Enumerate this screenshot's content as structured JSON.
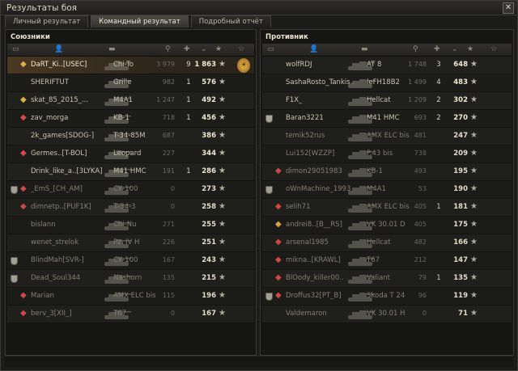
{
  "window": {
    "title": "Результаты боя",
    "close_glyph": "✕"
  },
  "tabs": [
    {
      "label": "Личный результат",
      "active": false
    },
    {
      "label": "Командный результат",
      "active": true
    },
    {
      "label": "Подробный отчёт",
      "active": false
    }
  ],
  "allies": {
    "title": "Союзники",
    "rows": [
      {
        "clan": false,
        "rank": "gold",
        "name": "DaRT_Ki..[USEC]",
        "vehicle": "Chi-To",
        "damage": "3 979",
        "kills": "9",
        "points": "1 863",
        "self": true,
        "dead": false,
        "medal": true
      },
      {
        "clan": false,
        "rank": "",
        "name": "SHERIFTUT",
        "vehicle": "Grille",
        "damage": "982",
        "kills": "1",
        "points": "576",
        "self": false,
        "dead": false,
        "medal": false
      },
      {
        "clan": false,
        "rank": "gold",
        "name": "skat_85_2015_...",
        "vehicle": "M4A1",
        "damage": "1 247",
        "kills": "1",
        "points": "492",
        "self": false,
        "dead": false,
        "medal": false
      },
      {
        "clan": false,
        "rank": "red",
        "name": "zav_morga",
        "vehicle": "KB-1",
        "damage": "718",
        "kills": "1",
        "points": "456",
        "self": false,
        "dead": false,
        "medal": false
      },
      {
        "clan": false,
        "rank": "",
        "name": "2k_games[SDOG-]",
        "vehicle": "T-34-85M",
        "damage": "687",
        "kills": "",
        "points": "386",
        "self": false,
        "dead": false,
        "medal": false
      },
      {
        "clan": false,
        "rank": "red",
        "name": "Germes..[T-BOL]",
        "vehicle": "Leopard",
        "damage": "227",
        "kills": "",
        "points": "344",
        "self": false,
        "dead": false,
        "medal": false
      },
      {
        "clan": false,
        "rank": "",
        "name": "Drink_like_a..[3LYKA]",
        "vehicle": "M41 HMC",
        "damage": "191",
        "kills": "1",
        "points": "286",
        "self": false,
        "dead": false,
        "medal": false
      },
      {
        "clan": true,
        "rank": "red",
        "name": "_EmS_[CH_AM]",
        "vehicle": "СУ-100",
        "damage": "0",
        "kills": "",
        "points": "273",
        "self": false,
        "dead": true,
        "medal": false
      },
      {
        "clan": false,
        "rank": "red",
        "name": "dimnetp..[PUF1K]",
        "vehicle": "Т-34-3",
        "damage": "0",
        "kills": "",
        "points": "258",
        "self": false,
        "dead": true,
        "medal": false
      },
      {
        "clan": false,
        "rank": "",
        "name": "bislann",
        "vehicle": "Chi-Nu",
        "damage": "271",
        "kills": "",
        "points": "255",
        "self": false,
        "dead": true,
        "medal": false
      },
      {
        "clan": false,
        "rank": "",
        "name": "wenet_strelok",
        "vehicle": "Pz. IV H",
        "damage": "226",
        "kills": "",
        "points": "251",
        "self": false,
        "dead": true,
        "medal": false
      },
      {
        "clan": true,
        "rank": "",
        "name": "BlindMah[SVR-]",
        "vehicle": "СУ-100",
        "damage": "167",
        "kills": "",
        "points": "243",
        "self": false,
        "dead": true,
        "medal": false
      },
      {
        "clan": true,
        "rank": "",
        "name": "Dead_Soul344",
        "vehicle": "Nashorn",
        "damage": "135",
        "kills": "",
        "points": "215",
        "self": false,
        "dead": true,
        "medal": false
      },
      {
        "clan": false,
        "rank": "red",
        "name": "Marian",
        "vehicle": "AMX ELC bis",
        "damage": "115",
        "kills": "",
        "points": "196",
        "self": false,
        "dead": true,
        "medal": false
      },
      {
        "clan": false,
        "rank": "red",
        "name": "berv_3[XII_]",
        "vehicle": "T67",
        "damage": "0",
        "kills": "",
        "points": "167",
        "self": false,
        "dead": true,
        "medal": false
      }
    ]
  },
  "enemies": {
    "title": "Противник",
    "rows": [
      {
        "clan": false,
        "rank": "",
        "name": "wolfRDJ",
        "vehicle": "AT 8",
        "damage": "1 748",
        "kills": "3",
        "points": "648",
        "dead": false
      },
      {
        "clan": false,
        "rank": "",
        "name": "SashaRosto_Tankis..",
        "vehicle": "leFH18B2",
        "damage": "1 499",
        "kills": "4",
        "points": "483",
        "dead": false
      },
      {
        "clan": false,
        "rank": "",
        "name": "F1X_",
        "vehicle": "Hellcat",
        "damage": "1 209",
        "kills": "2",
        "points": "302",
        "dead": false
      },
      {
        "clan": true,
        "rank": "",
        "name": "Baran3221",
        "vehicle": "M41 HMC",
        "damage": "693",
        "kills": "2",
        "points": "270",
        "dead": false
      },
      {
        "clan": false,
        "rank": "",
        "name": "temik52rus",
        "vehicle": "AMX ELC bis",
        "damage": "481",
        "kills": "",
        "points": "247",
        "dead": true
      },
      {
        "clan": false,
        "rank": "",
        "name": "Lui152[WZZP]",
        "vehicle": "P.43 bis",
        "damage": "738",
        "kills": "",
        "points": "209",
        "dead": true
      },
      {
        "clan": false,
        "rank": "red",
        "name": "dimon29051983",
        "vehicle": "KB-1",
        "damage": "493",
        "kills": "",
        "points": "195",
        "dead": true
      },
      {
        "clan": true,
        "rank": "",
        "name": "oWnMachine_1993",
        "vehicle": "M4A1",
        "damage": "53",
        "kills": "",
        "points": "190",
        "dead": true
      },
      {
        "clan": false,
        "rank": "red",
        "name": "selih71",
        "vehicle": "AMX ELC bis",
        "damage": "405",
        "kills": "1",
        "points": "181",
        "dead": true
      },
      {
        "clan": false,
        "rank": "gold",
        "name": "andrei8..[B__RS]",
        "vehicle": "VK 30.01 D",
        "damage": "405",
        "kills": "",
        "points": "175",
        "dead": true
      },
      {
        "clan": false,
        "rank": "red",
        "name": "arsenal1985",
        "vehicle": "Hellcat",
        "damage": "482",
        "kills": "",
        "points": "166",
        "dead": true
      },
      {
        "clan": false,
        "rank": "red",
        "name": "mikna..[KRAWL]",
        "vehicle": "T67",
        "damage": "212",
        "kills": "",
        "points": "147",
        "dead": true
      },
      {
        "clan": false,
        "rank": "red",
        "name": "BlOody_killer00..",
        "vehicle": "Valiant",
        "damage": "79",
        "kills": "1",
        "points": "135",
        "dead": true
      },
      {
        "clan": true,
        "rank": "red",
        "name": "Droffus32[PT_B]",
        "vehicle": "Škoda T 24",
        "damage": "96",
        "kills": "",
        "points": "119",
        "dead": true
      },
      {
        "clan": false,
        "rank": "",
        "name": "Valdemaron",
        "vehicle": "VK 30.01 H",
        "damage": "0",
        "kills": "",
        "points": "71",
        "dead": true
      }
    ]
  },
  "icons": {
    "star": "★",
    "rank": "◆",
    "medal": "☀"
  }
}
